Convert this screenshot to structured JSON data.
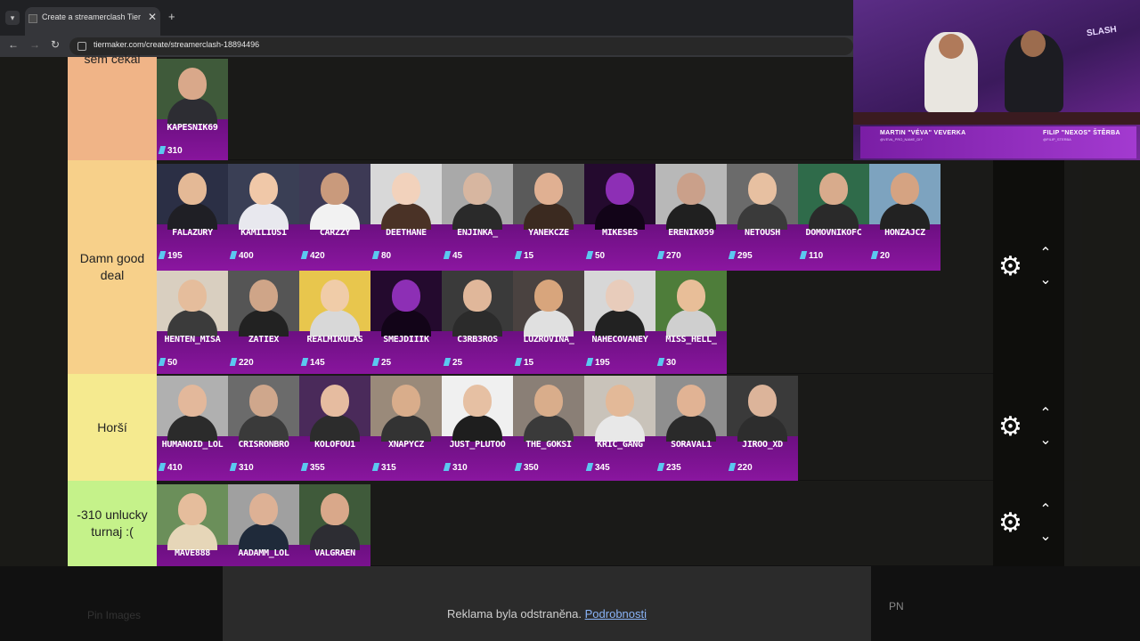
{
  "browser": {
    "tab_title": "Create a streamerclash Tier List",
    "url": "tiermaker.com/create/streamerclash-18894496",
    "new_tab_label": "+",
    "close_label": "✕"
  },
  "tiers": [
    {
      "label": "sem cekal",
      "color": "#f0b487",
      "cards": [
        {
          "name": "KAPESNIK69",
          "score": "310"
        }
      ]
    },
    {
      "label": "Damn good deal",
      "color": "#f7d08a",
      "cards": [
        {
          "name": "FALAZURY",
          "score": "195"
        },
        {
          "name": "KAMILIUS1",
          "score": "400"
        },
        {
          "name": "CARZZY",
          "score": "420"
        },
        {
          "name": "DEETHANE",
          "score": "80"
        },
        {
          "name": "ENJINKA_",
          "score": "45"
        },
        {
          "name": "YANEKCZE",
          "score": "15"
        },
        {
          "name": "MIKESES",
          "score": "50"
        },
        {
          "name": "ERENIK059",
          "score": "270"
        },
        {
          "name": "NETOUSH",
          "score": "295"
        },
        {
          "name": "DOMOVNIKOFC",
          "score": "110"
        },
        {
          "name": "HONZAJCZ",
          "score": "20"
        },
        {
          "name": "HENTEN_MISA",
          "score": "50"
        },
        {
          "name": "ZATIEX",
          "score": "220"
        },
        {
          "name": "REALMIKULAS",
          "score": "145"
        },
        {
          "name": "SMEJDIIIK",
          "score": "25"
        },
        {
          "name": "C3RB3ROS",
          "score": "25"
        },
        {
          "name": "LUZROVINA_",
          "score": "15"
        },
        {
          "name": "NAHECOVANEY",
          "score": "195"
        },
        {
          "name": "MISS_HELL_",
          "score": "30"
        }
      ]
    },
    {
      "label": "Horší",
      "color": "#f5ea8f",
      "cards": [
        {
          "name": "HUMANOID_LOL",
          "score": "410"
        },
        {
          "name": "CRISRONBRO",
          "score": "310"
        },
        {
          "name": "KOLOFOU1",
          "score": "355"
        },
        {
          "name": "XNAPYCZ",
          "score": "315"
        },
        {
          "name": "JUST_PLUTOO",
          "score": "310"
        },
        {
          "name": "THE_GOKSI",
          "score": "350"
        },
        {
          "name": "KRIC_GANG",
          "score": "345"
        },
        {
          "name": "SORAVAL1",
          "score": "235"
        },
        {
          "name": "JIROO_XD",
          "score": "220"
        }
      ]
    },
    {
      "label": "-310 unlucky turnaj :(",
      "color": "#c5f28a",
      "cards": [
        {
          "name": "MAVE888",
          "score": ""
        },
        {
          "name": "AADAMM_LOL",
          "score": ""
        },
        {
          "name": "VALGRAEN",
          "score": ""
        }
      ]
    }
  ],
  "controls": {
    "gear_icon": "gear-icon",
    "up_icon": "chevron-up-icon",
    "down_icon": "chevron-down-icon"
  },
  "stream_overlay": {
    "brand": "SLASH",
    "host_left": "MARTIN \"VÉVA\" VEVERKA",
    "host_left_sub": "@VEVA_PRO_NAME_DIY",
    "host_right": "FILIP \"NEXOS\" ŠTĚRBA",
    "host_right_sub": "@FILIP_STERBA"
  },
  "ad": {
    "pin_text": "Pin Images",
    "removed_text": "Reklama byla odstraněna.",
    "details_link": "Podrobnosti",
    "right_label": "PN"
  }
}
